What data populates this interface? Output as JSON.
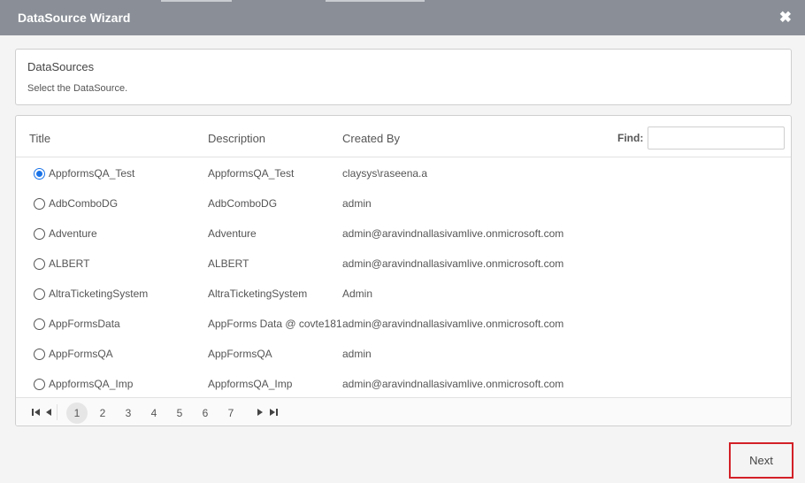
{
  "dialog": {
    "title": "DataSource Wizard",
    "close_glyph": "✖"
  },
  "info": {
    "heading": "DataSources",
    "subtitle": "Select the DataSource."
  },
  "grid": {
    "columns": {
      "title": "Title",
      "description": "Description",
      "created_by": "Created By"
    },
    "find_label": "Find:",
    "find_value": "",
    "rows": [
      {
        "title": "AppformsQA_Test",
        "description": "AppformsQA_Test",
        "created_by": "claysys\\raseena.a",
        "selected": true
      },
      {
        "title": "AdbComboDG",
        "description": "AdbComboDG",
        "created_by": "admin",
        "selected": false
      },
      {
        "title": "Adventure",
        "description": "Adventure",
        "created_by": "admin@aravindnallasivamlive.onmicrosoft.com",
        "selected": false
      },
      {
        "title": "ALBERT",
        "description": "ALBERT",
        "created_by": "admin@aravindnallasivamlive.onmicrosoft.com",
        "selected": false
      },
      {
        "title": "AltraTicketingSystem",
        "description": "AltraTicketingSystem",
        "created_by": "Admin",
        "selected": false
      },
      {
        "title": "AppFormsData",
        "description": "AppForms Data @ covte181",
        "created_by": "admin@aravindnallasivamlive.onmicrosoft.com",
        "selected": false
      },
      {
        "title": "AppFormsQA",
        "description": "AppFormsQA",
        "created_by": "admin",
        "selected": false
      },
      {
        "title": "AppformsQA_Imp",
        "description": "AppformsQA_Imp",
        "created_by": "admin@aravindnallasivamlive.onmicrosoft.com",
        "selected": false
      }
    ]
  },
  "pager": {
    "pages": [
      "1",
      "2",
      "3",
      "4",
      "5",
      "6",
      "7"
    ],
    "current_page": "1",
    "icons": [
      "first-page-icon",
      "prev-page-icon",
      "next-page-icon",
      "last-page-icon"
    ]
  },
  "footer": {
    "next_label": "Next"
  },
  "colors": {
    "titlebar": "#8a8f97",
    "accent": "#1a73e8",
    "highlight": "#d32027"
  }
}
